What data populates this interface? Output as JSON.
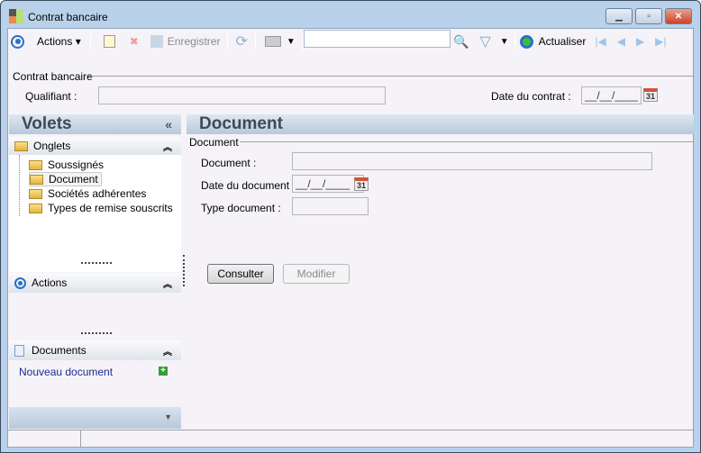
{
  "window": {
    "title": "Contrat bancaire"
  },
  "toolbar": {
    "actions": "Actions",
    "save": "Enregistrer",
    "search_value": "",
    "refresh": "Actualiser"
  },
  "header": {
    "group": "Contrat bancaire",
    "qualifiant_label": "Qualifiant :",
    "qualifiant_value": "",
    "date_label": "Date du contrat :",
    "date_value": "__/__/____",
    "cal_day": "31"
  },
  "sidebar": {
    "title": "Volets",
    "collapse": "«",
    "onglets": "Onglets",
    "tree": [
      "Soussignés",
      "Document",
      "Sociétés adhérentes",
      "Types de remise souscrits"
    ],
    "actions": "Actions",
    "documents": "Documents",
    "new_doc": "Nouveau document"
  },
  "main": {
    "title": "Document",
    "group": "Document",
    "doc_label": "Document :",
    "doc_value": "",
    "date_label": "Date du document :",
    "date_value": "__/__/____",
    "type_label": "Type document :",
    "type_value": "",
    "consult": "Consulter",
    "modify": "Modifier"
  }
}
